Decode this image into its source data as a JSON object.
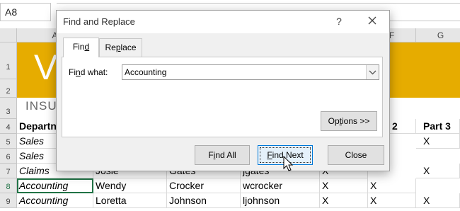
{
  "sheet": {
    "name_box": "A8",
    "columns": [
      "A",
      "F",
      "G"
    ],
    "rows": [
      "1",
      "2",
      "3",
      "4",
      "5",
      "6",
      "7",
      "8",
      "9"
    ],
    "banner_logo": "V",
    "subtitle": "INSU",
    "header_row": {
      "department": "Departn",
      "part2": "rt 2",
      "part3": "Part 3"
    },
    "r5": {
      "a": "Sales",
      "g": "X"
    },
    "r6": {
      "a": "Sales"
    },
    "r7": {
      "a": "Claims",
      "b": "Josie",
      "c": "Gates",
      "d": "jgates",
      "e": "X",
      "g": "X"
    },
    "r8": {
      "a": "Accounting",
      "b": "Wendy",
      "c": "Crocker",
      "d": "wcrocker",
      "e": "X",
      "f": "X"
    },
    "r9": {
      "a": "Accounting",
      "b": "Loretta",
      "c": "Johnson",
      "d": "ljohnson",
      "e": "X",
      "f": "X",
      "g": "X"
    }
  },
  "dialog": {
    "title": "Find and Replace",
    "help": "?",
    "tabs": [
      {
        "label_pre": "Fin",
        "label_ul": "d",
        "label_post": ""
      },
      {
        "label_pre": "Re",
        "label_ul": "p",
        "label_post": "lace"
      }
    ],
    "find_label_pre": "Fi",
    "find_label_ul": "n",
    "find_label_post": "d what:",
    "find_value": "Accounting",
    "options": {
      "pre": "Op",
      "ul": "t",
      "post": "ions >>"
    },
    "find_all": {
      "pre": "F",
      "ul": "i",
      "post": "nd All"
    },
    "find_next": {
      "pre": "",
      "ul": "F",
      "post": "ind Next"
    },
    "close": "Close"
  },
  "colors": {
    "banner": "#e6ac00",
    "selection": "#217346",
    "focus": "#0078d7"
  }
}
